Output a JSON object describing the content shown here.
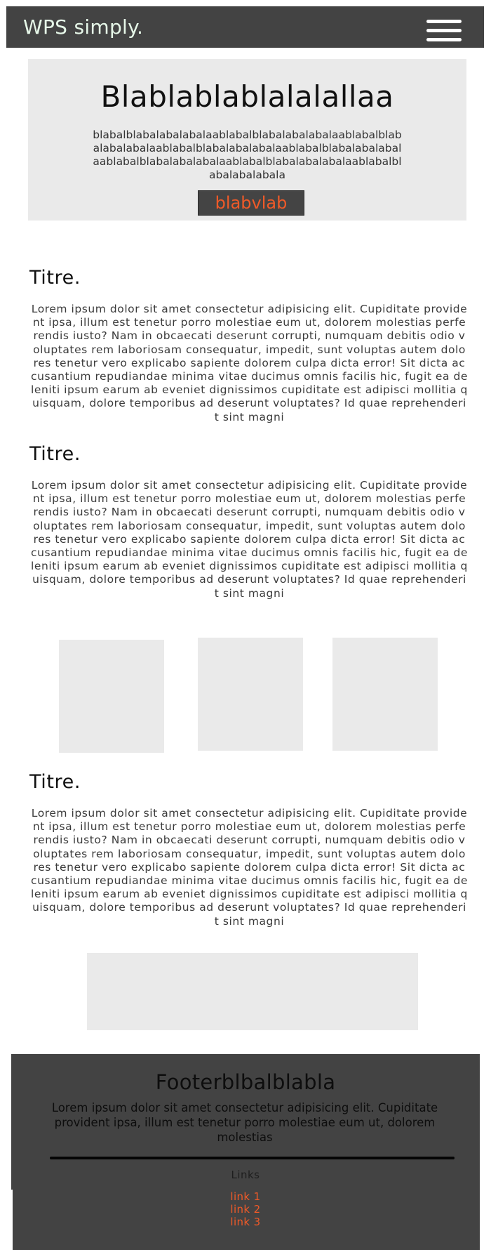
{
  "navbar": {
    "brand": "WPS simply.",
    "brand_color": "#e6f7e8",
    "background": "#434343",
    "menu_icon": "hamburger-menu-icon"
  },
  "hero": {
    "title": "Blablablablalalallaa",
    "text": "blabalblabalabalabalaablabalblabalabalabalaablabalblabalabalabalaablabalblabalabalabalaablabalblabalabalabalaablabalblabalabalabalaablabalblabalabalabalaablabalblabalabalabala",
    "button_label": "blabvlab",
    "button_text_color": "#f05a28"
  },
  "sections": [
    {
      "title": "Titre.",
      "text": "Lorem ipsum dolor sit amet consectetur adipisicing elit. Cupiditate provident ipsa, illum est tenetur porro molestiae eum ut, dolorem molestias perferendis iusto? Nam in obcaecati deserunt corrupti, numquam debitis odio voluptates rem laboriosam consequatur, impedit, sunt voluptas autem dolores tenetur vero explicabo sapiente dolorem culpa dicta error! Sit dicta accusantium repudiandae minima vitae ducimus omnis facilis hic, fugit ea deleniti ipsum earum ab eveniet dignissimos cupiditate est adipisci mollitia quisquam, dolore temporibus ad deserunt voluptates? Id quae reprehenderit sint magni"
    },
    {
      "title": "Titre.",
      "text": "Lorem ipsum dolor sit amet consectetur adipisicing elit. Cupiditate provident ipsa, illum est tenetur porro molestiae eum ut, dolorem molestias perferendis iusto? Nam in obcaecati deserunt corrupti, numquam debitis odio voluptates rem laboriosam consequatur, impedit, sunt voluptas autem dolores tenetur vero explicabo sapiente dolorem culpa dicta error! Sit dicta accusantium repudiandae minima vitae ducimus omnis facilis hic, fugit ea deleniti ipsum earum ab eveniet dignissimos cupiditate est adipisci mollitia quisquam, dolore temporibus ad deserunt voluptates? Id quae reprehenderit sint magni"
    },
    {
      "title": "Titre.",
      "text": "Lorem ipsum dolor sit amet consectetur adipisicing elit. Cupiditate provident ipsa, illum est tenetur porro molestiae eum ut, dolorem molestias perferendis iusto? Nam in obcaecati deserunt corrupti, numquam debitis odio voluptates rem laboriosam consequatur, impedit, sunt voluptas autem dolores tenetur vero explicabo sapiente dolorem culpa dicta error! Sit dicta accusantium repudiandae minima vitae ducimus omnis facilis hic, fugit ea deleniti ipsum earum ab eveniet dignissimos cupiditate est adipisci mollitia quisquam, dolore temporibus ad deserunt voluptates? Id quae reprehenderit sint magni"
    }
  ],
  "placeholder_color": "#eaeaea",
  "footer": {
    "title": "Footerblbalblabla",
    "text": "Lorem ipsum dolor sit amet consectetur adipisicing elit. Cupiditate provident ipsa, illum est tenetur porro molestiae eum ut, dolorem molestias",
    "links_heading": "Links",
    "links": [
      "link 1",
      "link 2",
      "link 3"
    ],
    "link_color": "#f05a28",
    "background": "#434343"
  }
}
